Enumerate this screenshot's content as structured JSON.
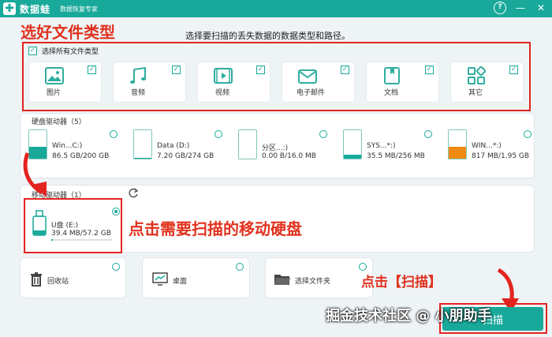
{
  "app": {
    "name": "数据蛙",
    "slogan": "数据恢复专家",
    "logo_mark": "✚"
  },
  "window": {
    "help_icon": "?",
    "minimize_icon": "—",
    "close_icon": "✕"
  },
  "annotations": {
    "select_type": "选好文件类型",
    "click_drive": "点击需要扫描的移动硬盘",
    "click_scan": "点击【扫描】",
    "color": "#e0321e"
  },
  "instruction": "选择要扫描的丢失数据的数据类型和路径。",
  "file_types": {
    "select_all": "选择所有文件类型",
    "items": [
      {
        "label": "图片",
        "icon": "image-icon"
      },
      {
        "label": "音频",
        "icon": "music-icon"
      },
      {
        "label": "视频",
        "icon": "video-icon"
      },
      {
        "label": "电子邮件",
        "icon": "mail-icon"
      },
      {
        "label": "文档",
        "icon": "document-icon"
      },
      {
        "label": "其它",
        "icon": "other-icon"
      }
    ]
  },
  "hard_drives": {
    "title": "硬盘驱动器（5）",
    "items": [
      {
        "name": "Win...C:)",
        "size": "86.5 GB/200 GB",
        "used_fraction": 0.43,
        "color": "#19a99a"
      },
      {
        "name": "Data (D:)",
        "size": "7.20 GB/274 GB",
        "used_fraction": 0.03,
        "color": "#19a99a"
      },
      {
        "name": "分区...:)",
        "size": "0.00  B/16.0 MB",
        "used_fraction": 0.0,
        "color": "#19a99a"
      },
      {
        "name": "SYS...*:)",
        "size": "35.5 MB/256 MB",
        "used_fraction": 0.14,
        "color": "#19a99a"
      },
      {
        "name": "WIN...*:)",
        "size": "817 MB/1.95 GB",
        "used_fraction": 0.42,
        "color": "#f08a12"
      }
    ]
  },
  "removable": {
    "title": "移动驱动器（1）",
    "refresh_icon": "refresh-icon",
    "items": [
      {
        "name": "U盘 (E:)",
        "size": "39.4 MB/57.2 GB",
        "used_fraction": 0.01
      }
    ]
  },
  "locations": [
    {
      "label": "回收站",
      "icon": "trash-icon"
    },
    {
      "label": "桌面",
      "icon": "desktop-icon"
    },
    {
      "label": "选择文件夹",
      "icon": "folder-icon"
    }
  ],
  "scan_button": "扫描",
  "watermark": "掘金技术社区 @ 小朋助手",
  "colors": {
    "accent": "#19a99a",
    "highlight": "#e3241f"
  }
}
